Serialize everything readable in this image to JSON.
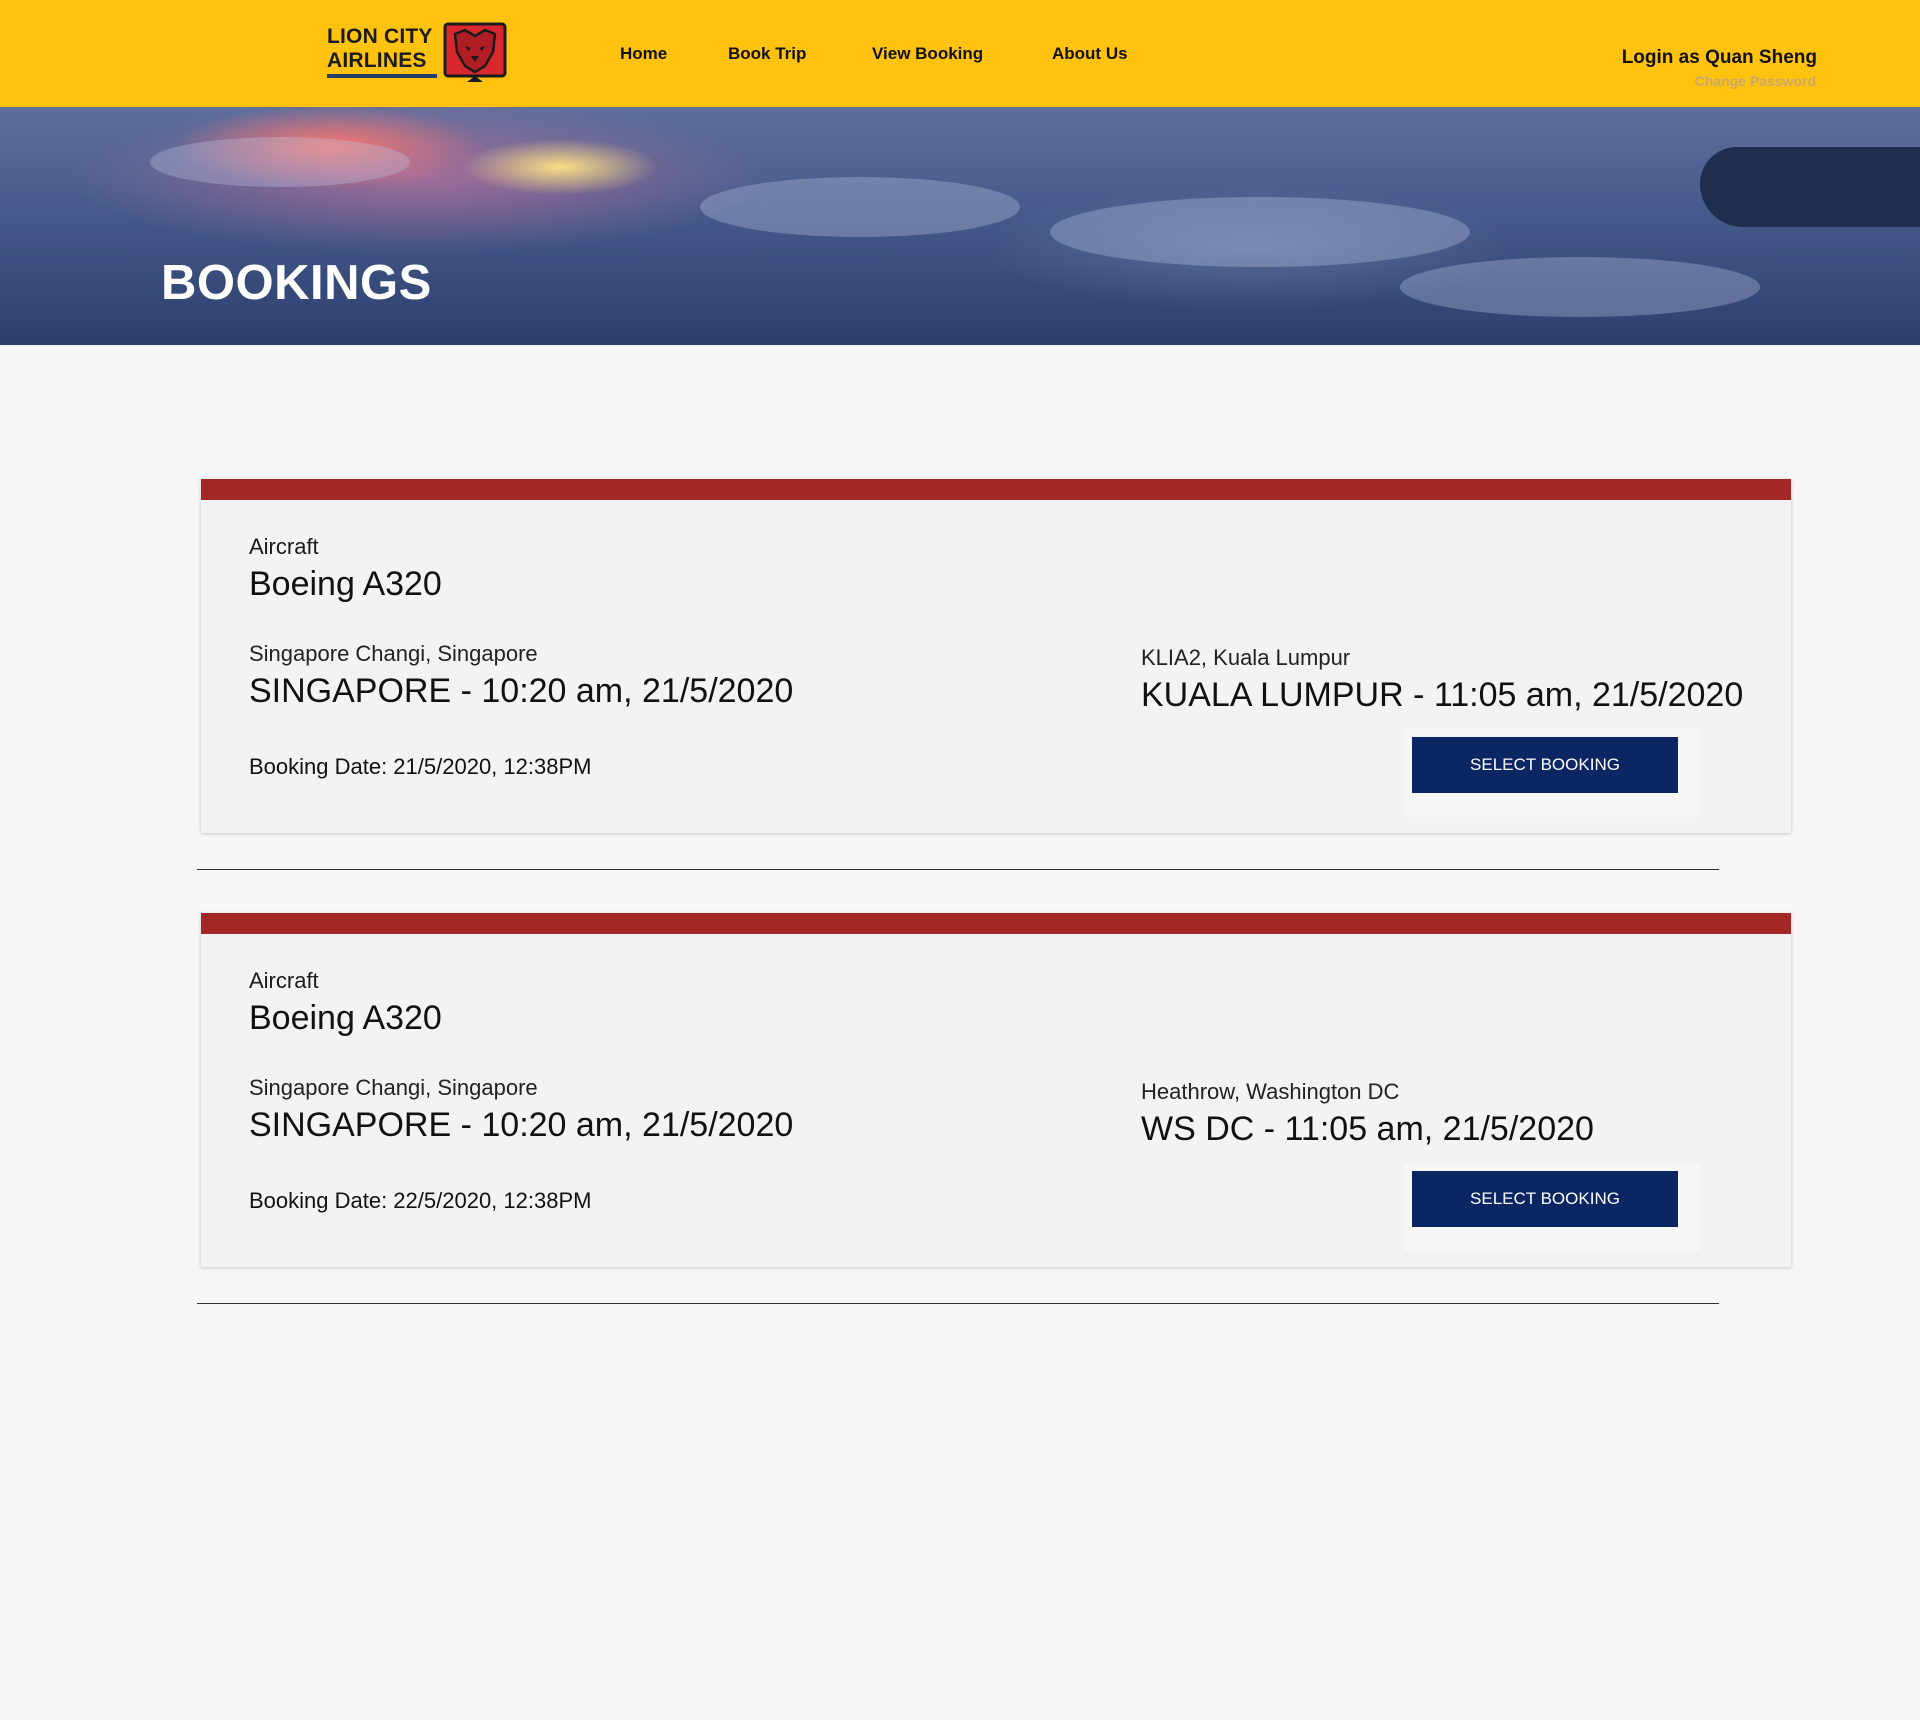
{
  "brand": {
    "line1": "LION CITY",
    "line2": "AIRLINES",
    "badge_icon": "lion-head-icon",
    "colors": {
      "header_bg": "#ffc20e",
      "card_bar": "#a32727",
      "button_bg": "#0c2664",
      "underline": "#23406b"
    }
  },
  "nav": {
    "home": "Home",
    "book_trip": "Book Trip",
    "view_booking": "View Booking",
    "about_us": "About Us"
  },
  "user": {
    "login_text": "Login as Quan Sheng",
    "change_password": "Change Password"
  },
  "hero": {
    "title": "BOOKINGS"
  },
  "bookings": [
    {
      "aircraft_label": "Aircraft",
      "aircraft": "Boeing A320",
      "from_airport": "Singapore Changi, Singapore",
      "from_time": "SINGAPORE - 10:20 am, 21/5/2020",
      "to_airport": "KLIA2, Kuala Lumpur",
      "to_time": "KUALA LUMPUR - 11:05 am, 21/5/2020",
      "booking_date": "Booking Date: 21/5/2020, 12:38PM",
      "button": "SELECT BOOKING"
    },
    {
      "aircraft_label": "Aircraft",
      "aircraft": "Boeing A320",
      "from_airport": "Singapore Changi, Singapore",
      "from_time": "SINGAPORE - 10:20 am, 21/5/2020",
      "to_airport": "Heathrow, Washington DC",
      "to_time": "WS DC - 11:05 am, 21/5/2020",
      "booking_date": "Booking Date: 22/5/2020, 12:38PM",
      "button": "SELECT BOOKING"
    }
  ]
}
